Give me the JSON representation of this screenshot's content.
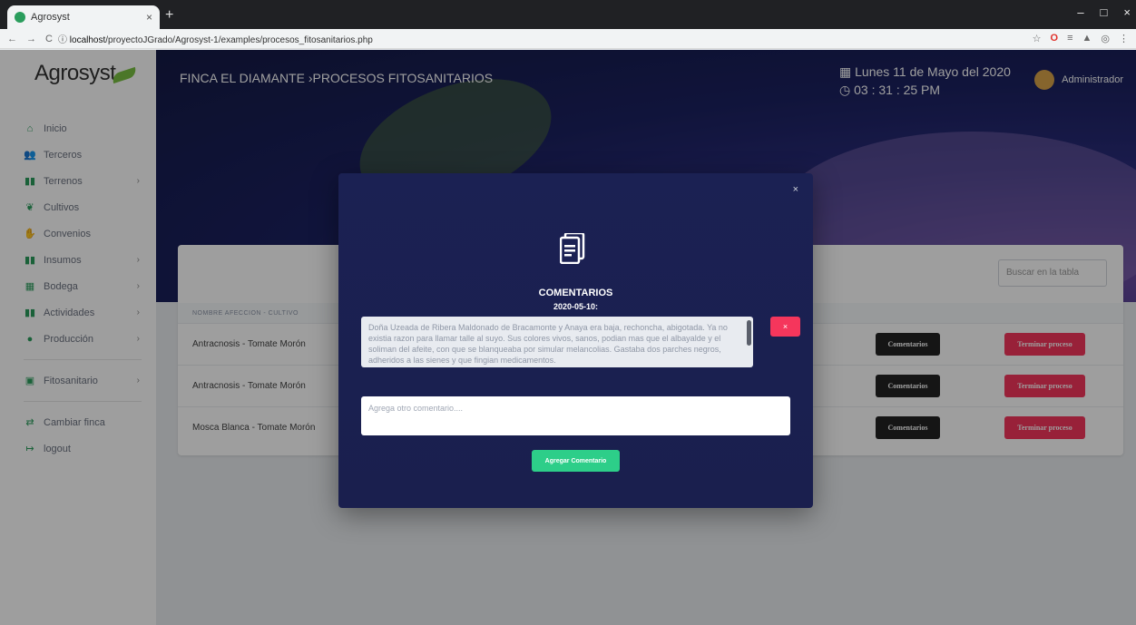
{
  "browser": {
    "tab_title": "Agrosyst",
    "tab_close": "×",
    "new_tab": "+",
    "url_host": "localhost",
    "url_path": "/proyectoJGrado/Agrosyst-1/examples/procesos_fitosanitarios.php",
    "window_controls": [
      "–",
      "□",
      "×"
    ]
  },
  "sidebar": {
    "logo": "Agrosyst",
    "items": [
      {
        "label": "Inicio",
        "icon": "home-icon",
        "glyph": "⌂",
        "arrow": ""
      },
      {
        "label": "Terceros",
        "icon": "users-icon",
        "glyph": "👥",
        "arrow": ""
      },
      {
        "label": "Terrenos",
        "icon": "map-icon",
        "glyph": "▮▮",
        "arrow": "›"
      },
      {
        "label": "Cultivos",
        "icon": "seedling-icon",
        "glyph": "❦",
        "arrow": ""
      },
      {
        "label": "Convenios",
        "icon": "handshake-icon",
        "glyph": "✋",
        "arrow": ""
      },
      {
        "label": "Insumos",
        "icon": "boxes-icon",
        "glyph": "▮▮",
        "arrow": "›"
      },
      {
        "label": "Bodega",
        "icon": "warehouse-icon",
        "glyph": "▦",
        "arrow": "›"
      },
      {
        "label": "Actividades",
        "icon": "tasks-icon",
        "glyph": "▮▮",
        "arrow": "›"
      },
      {
        "label": "Producción",
        "icon": "leaf-icon",
        "glyph": "●",
        "arrow": "›"
      },
      {
        "label": "Fitosanitario",
        "icon": "medkit-icon",
        "glyph": "▣",
        "arrow": "›"
      },
      {
        "label": "Cambiar finca",
        "icon": "exchange-icon",
        "glyph": "⇄",
        "arrow": ""
      },
      {
        "label": "logout",
        "icon": "logout-icon",
        "glyph": "↦",
        "arrow": ""
      }
    ]
  },
  "header": {
    "breadcrumb": "FINCA EL DIAMANTE ›PROCESOS FITOSANITARIOS",
    "date": "Lunes 11 de Mayo del 2020",
    "time": "03 : 31 : 25 PM",
    "user": "Administrador"
  },
  "table": {
    "search_placeholder": "Buscar en la tabla",
    "column_header": "NOMBRE AFECCION - CULTIVO",
    "rows": [
      {
        "name": "Antracnosis - Tomate Morón",
        "comments_label": "Comentarios",
        "finish_label": "Terminar proceso"
      },
      {
        "name": "Antracnosis - Tomate Morón",
        "comments_label": "Comentarios",
        "finish_label": "Terminar proceso"
      },
      {
        "name": "Mosca Blanca - Tomate Morón",
        "comments_label": "Comentarios",
        "finish_label": "Terminar proceso"
      }
    ]
  },
  "modal": {
    "close": "×",
    "title": "COMENTARIOS",
    "comment_date": "2020-05-10:",
    "comment_text": "Doña Uzeada de Ribera Maldonado de Bracamonte y Anaya era baja, rechoncha, abigotada. Ya no existia razon para llamar talle al suyo. Sus colores vivos, sanos, podian mas que el albayalde y el soliman del afeite, con que se blanqueaba por simular melancolias. Gastaba dos parches negros, adheridos a las sienes y que fingian medicamentos.",
    "delete_label": "×",
    "new_comment_placeholder": "Agrega otro comentario....",
    "add_button": "Agregar Comentario"
  },
  "colors": {
    "accent_green": "#2dce89",
    "danger": "#f5365c",
    "modal_bg": "#1b2153"
  }
}
